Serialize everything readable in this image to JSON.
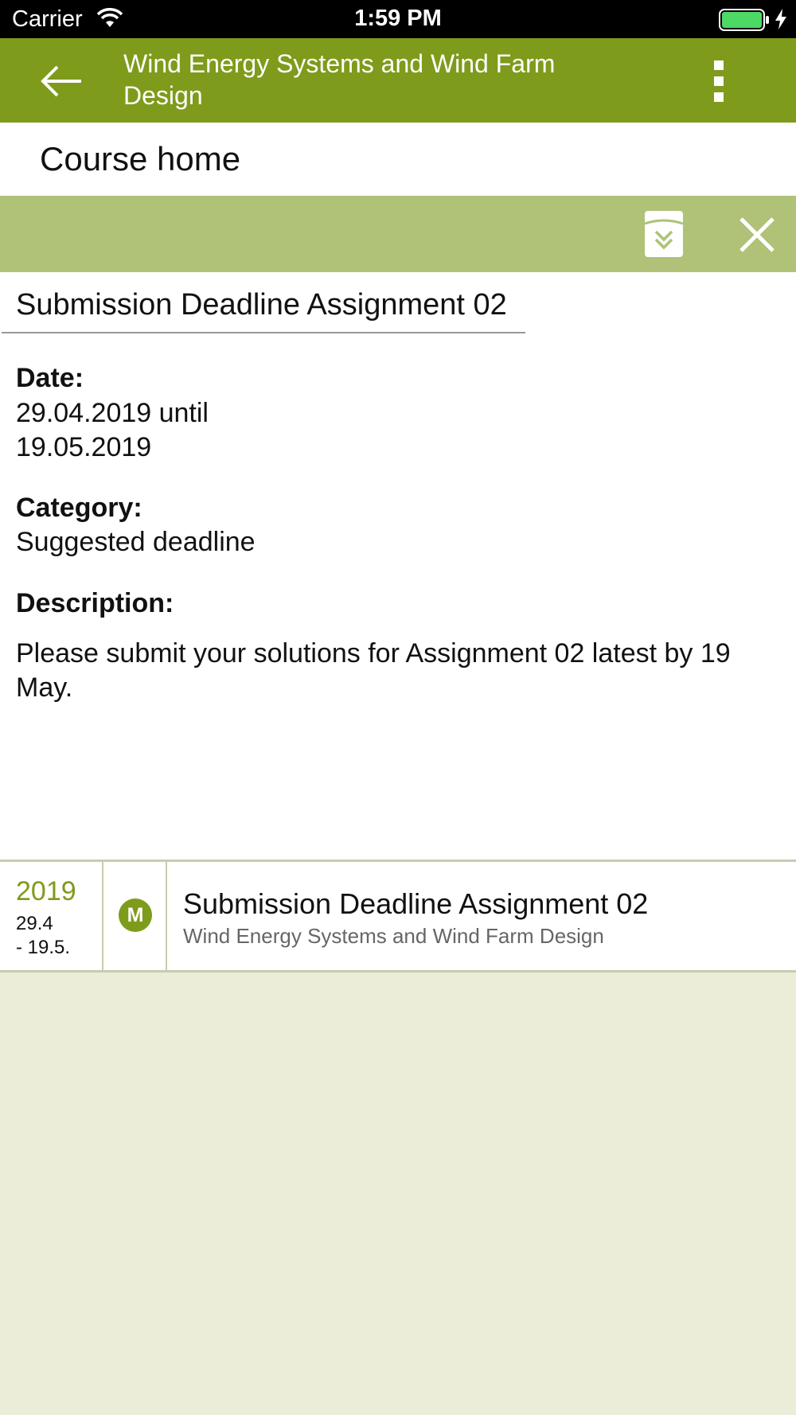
{
  "status_bar": {
    "carrier": "Carrier",
    "time": "1:59 PM",
    "battery_color": "#4cd964"
  },
  "app_bar": {
    "title": "Wind Energy Systems and Wind Farm Design",
    "back_icon": "arrow-left-icon",
    "menu_icon": "more-vertical-icon",
    "color": "#7e9b1b"
  },
  "course_nav": {
    "label": "Course home"
  },
  "toolbar": {
    "export_icon": "calendar-export-icon",
    "close_icon": "close-icon",
    "color": "#afc277"
  },
  "event": {
    "title": "Submission Deadline Assignment 02",
    "date_label": "Date:",
    "date_line1": "29.04.2019 until",
    "date_line2": "19.05.2019",
    "category_label": "Category:",
    "category_value": "Suggested deadline",
    "description_label": "Description:",
    "description_text": "Please submit your solutions for Assignment 02 latest by 19 May."
  },
  "list": {
    "items": [
      {
        "year": "2019",
        "range_start": "29.4",
        "range_end": "- 19.5.",
        "badge": "M",
        "title": "Submission Deadline Assignment 02",
        "subtitle": "Wind Energy Systems and Wind Farm Design"
      }
    ]
  }
}
